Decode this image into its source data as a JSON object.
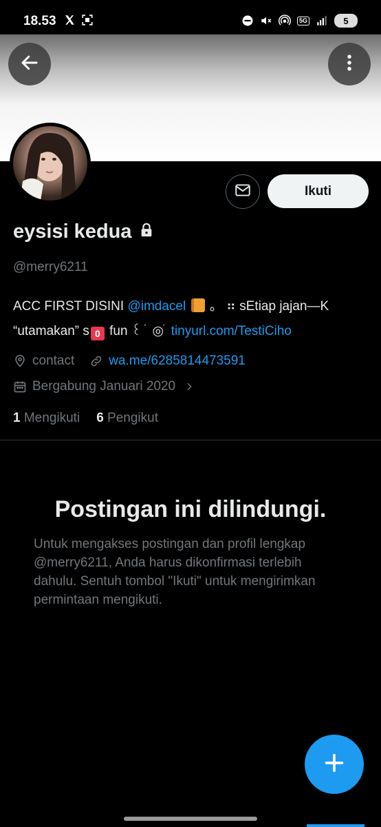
{
  "status_bar": {
    "time": "18.53",
    "network_badge": "5G",
    "battery": "5"
  },
  "profile": {
    "display_name": "eysisi kedua",
    "handle": "@merry6211",
    "bio_line1_prefix": "ACC FIRST DISINI ",
    "bio_mention": "@imdacel",
    "bio_line1_suffix": " 。 ⠶ sEtiap jajan—K",
    "bio_line2_prefix": "“utamakan” s",
    "bio_line2_mid": " fun  ꒰ ֹ ֹ ◎ ֹ ",
    "bio_link": "tinyurl.com/TestiCiho",
    "location": "contact",
    "website": "wa.me/6285814473591",
    "joined": "Bergabung Januari 2020",
    "following_count": "1",
    "following_label": "Mengikuti",
    "followers_count": "6",
    "followers_label": "Pengikut"
  },
  "actions": {
    "follow_label": "Ikuti"
  },
  "protected": {
    "title": "Postingan ini dilindungi.",
    "description": "Untuk mengakses postingan dan profil lengkap @merry6211, Anda harus dikonfirmasi terlebih dahulu. Sentuh tombol \"Ikuti\" untuk mengirimkan permintaan mengikuti."
  },
  "icons": {
    "back": "arrow-left-icon",
    "more": "more-vertical-icon",
    "message": "envelope-icon",
    "lock": "lock-icon",
    "location": "location-pin-icon",
    "link": "link-icon",
    "calendar": "calendar-icon",
    "compose": "plus-icon"
  },
  "colors": {
    "accent": "#1d9bf0",
    "background": "#000000",
    "secondary_text": "#71767b"
  }
}
